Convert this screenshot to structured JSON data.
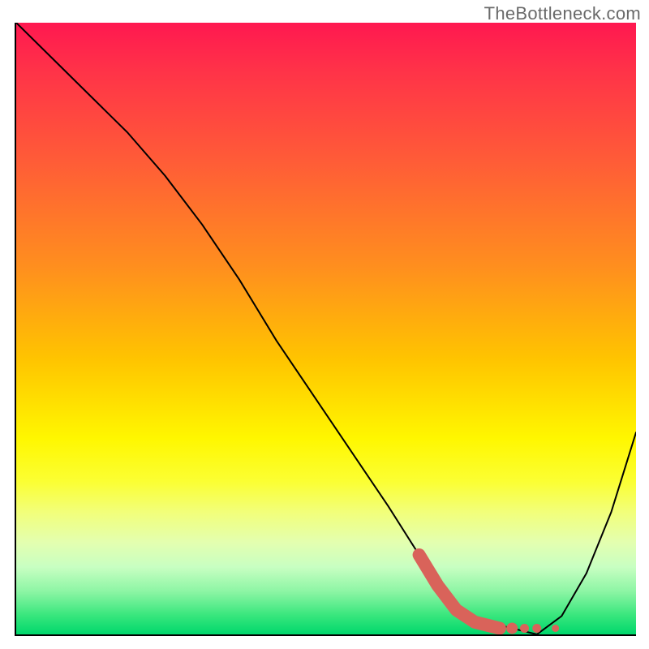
{
  "watermark": "TheBottleneck.com",
  "chart_data": {
    "type": "line",
    "title": "",
    "xlabel": "",
    "ylabel": "",
    "xlim": [
      0,
      100
    ],
    "ylim": [
      0,
      100
    ],
    "grid": false,
    "legend": false,
    "series": [
      {
        "name": "curve",
        "color": "#000000",
        "x": [
          0,
          6,
          12,
          18,
          24,
          30,
          36,
          42,
          48,
          54,
          60,
          65,
          68,
          72,
          76,
          80,
          84,
          88,
          92,
          96,
          100
        ],
        "y": [
          100,
          94,
          88,
          82,
          75,
          67,
          58,
          48,
          39,
          30,
          21,
          13,
          8,
          4,
          2,
          1,
          0,
          3,
          10,
          20,
          33
        ]
      },
      {
        "name": "highlight-thick",
        "color": "#d9635a",
        "style": "thick",
        "x": [
          65,
          68,
          71,
          74,
          76,
          78
        ],
        "y": [
          13,
          8,
          4,
          2,
          1.5,
          1
        ]
      },
      {
        "name": "highlight-dots",
        "color": "#d9635a",
        "style": "dots",
        "x": [
          80,
          82,
          84,
          87
        ],
        "y": [
          1,
          1,
          1,
          1
        ]
      }
    ]
  }
}
